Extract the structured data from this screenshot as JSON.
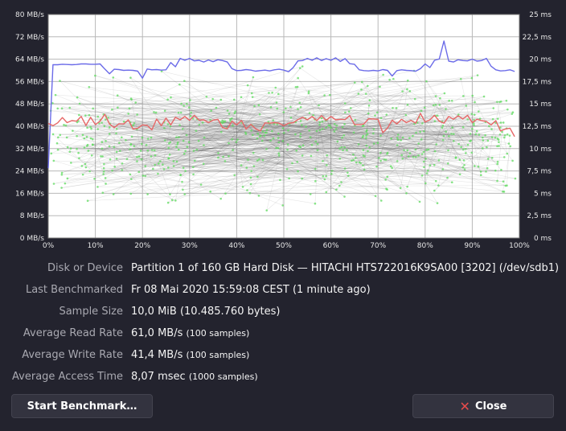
{
  "chart_data": {
    "type": "line",
    "y_left": {
      "unit": "MB/s",
      "ticks": [
        "0 MB/s",
        "8 MB/s",
        "16 MB/s",
        "24 MB/s",
        "32 MB/s",
        "40 MB/s",
        "48 MB/s",
        "56 MB/s",
        "64 MB/s",
        "72 MB/s",
        "80 MB/s"
      ],
      "range": [
        0,
        80
      ]
    },
    "y_right": {
      "unit": "ms",
      "ticks": [
        "0 ms",
        "2,5 ms",
        "5 ms",
        "7,5 ms",
        "10 ms",
        "12,5 ms",
        "15 ms",
        "17,5 ms",
        "20 ms",
        "22,5 ms",
        "25 ms"
      ],
      "range": [
        0,
        25
      ]
    },
    "x_axis": {
      "ticks": [
        "0%",
        "10%",
        "20%",
        "30%",
        "40%",
        "50%",
        "60%",
        "70%",
        "80%",
        "90%",
        "100%"
      ],
      "range": [
        0,
        100
      ]
    },
    "grid": true,
    "series": [
      {
        "name": "read",
        "color": "#6b6be8",
        "x": [
          0,
          1,
          2,
          3,
          4,
          5,
          6,
          7,
          8,
          9,
          10,
          11,
          12,
          13,
          14,
          15,
          16,
          17,
          18,
          19,
          20,
          21,
          22,
          23,
          24,
          25,
          26,
          27,
          28,
          29,
          30,
          31,
          32,
          33,
          34,
          35,
          36,
          37,
          38,
          39,
          40,
          41,
          42,
          43,
          44,
          45,
          46,
          47,
          48,
          49,
          50,
          51,
          52,
          53,
          54,
          55,
          56,
          57,
          58,
          59,
          60,
          61,
          62,
          63,
          64,
          65,
          66,
          67,
          68,
          69,
          70,
          71,
          72,
          73,
          74,
          75,
          76,
          77,
          78,
          79,
          80,
          81,
          82,
          83,
          84,
          85,
          86,
          87,
          88,
          89,
          90,
          91,
          92,
          93,
          94,
          95,
          96,
          97,
          98,
          99
        ],
        "values": [
          25,
          62,
          62,
          62.2,
          62.1,
          62,
          62.1,
          62.3,
          62.3,
          62.2,
          62.2,
          62.3,
          60.5,
          58.8,
          60.4,
          60.3,
          60,
          60.1,
          60,
          59.7,
          57.2,
          60.5,
          60.2,
          60.3,
          60.1,
          60.2,
          62.8,
          61.3,
          64.3,
          63.6,
          64.3,
          63.4,
          63.6,
          63,
          63.7,
          63.1,
          63.8,
          63.5,
          63,
          60.6,
          59.9,
          60,
          60.3,
          60.1,
          59.7,
          59.9,
          60.1,
          59.8,
          60.2,
          60.4,
          60.1,
          59.5,
          61,
          63.4,
          63.5,
          64.3,
          63.6,
          64.5,
          63.5,
          64.2,
          63.6,
          64.5,
          63.2,
          64.2,
          62.4,
          62.2,
          60.2,
          59.9,
          59.8,
          60,
          59.8,
          60.3,
          60,
          58,
          59.9,
          60.2,
          60,
          59.9,
          59.7,
          60.6,
          62.3,
          61,
          63.6,
          64.1,
          70.5,
          63.3,
          63,
          63.8,
          63.5,
          63.4,
          64,
          63.3,
          63.5,
          64.3,
          61.5,
          60.2,
          59.8,
          59.9,
          60.2,
          59.6
        ]
      },
      {
        "name": "write",
        "color": "#e66767",
        "x": [
          0,
          1,
          2,
          3,
          4,
          5,
          6,
          7,
          8,
          9,
          10,
          11,
          12,
          13,
          14,
          15,
          16,
          17,
          18,
          19,
          20,
          21,
          22,
          23,
          24,
          25,
          26,
          27,
          28,
          29,
          30,
          31,
          32,
          33,
          34,
          35,
          36,
          37,
          38,
          39,
          40,
          41,
          42,
          43,
          44,
          45,
          46,
          47,
          48,
          49,
          50,
          51,
          52,
          53,
          54,
          55,
          56,
          57,
          58,
          59,
          60,
          61,
          62,
          63,
          64,
          65,
          66,
          67,
          68,
          69,
          70,
          71,
          72,
          73,
          74,
          75,
          76,
          77,
          78,
          79,
          80,
          81,
          82,
          83,
          84,
          85,
          86,
          87,
          88,
          89,
          90,
          91,
          92,
          93,
          94,
          95,
          96,
          97,
          98,
          99
        ],
        "values": [
          41,
          40.2,
          41.2,
          43.1,
          41.3,
          42,
          41.8,
          43.5,
          40.3,
          43.2,
          40.6,
          41.8,
          44.3,
          40.8,
          39.5,
          40.9,
          40.8,
          42.3,
          39,
          39.3,
          40.5,
          40.3,
          38.7,
          42.6,
          40.2,
          42.9,
          40.5,
          43.2,
          42.3,
          43.5,
          42.1,
          43.9,
          42.2,
          42.3,
          41.3,
          42.2,
          42.5,
          39.5,
          39.1,
          41.8,
          40.5,
          42.1,
          39,
          40.7,
          39.1,
          38.3,
          41.2,
          41.1,
          41.3,
          41.1,
          40.2,
          41.1,
          41.3,
          42.4,
          43.2,
          42.3,
          43.5,
          42,
          43.8,
          42.1,
          43.5,
          42.3,
          42.5,
          42.4,
          43.8,
          40.6,
          40.6,
          40.8,
          42.7,
          42.6,
          42.5,
          37.7,
          39.3,
          42.2,
          40.8,
          42.5,
          41.3,
          42.1,
          41.1,
          44.6,
          41.5,
          42.3,
          43.9,
          41.8,
          41.1,
          43.5,
          42.5,
          43.7,
          42.6,
          43.9,
          41.3,
          42.5,
          42,
          41.7,
          40.5,
          42,
          38.3,
          39,
          39.3,
          36.3
        ]
      }
    ]
  },
  "colors": {
    "background": "#23232e",
    "plot_bg": "#ffffff",
    "read": "#6b6be8",
    "write": "#e66767",
    "access_points": "#5fdc5f"
  },
  "info": {
    "disk": {
      "label": "Disk or Device",
      "value": "Partition 1 of 160 GB Hard Disk — HITACHI HTS722016K9SA00 [3202] (/dev/sdb1)"
    },
    "last": {
      "label": "Last Benchmarked",
      "value": "Fr 08 Mai 2020 15:59:08 CEST (1 minute ago)"
    },
    "sample": {
      "label": "Sample Size",
      "value": "10,0 MiB (10.485.760 bytes)"
    },
    "read": {
      "label": "Average Read Rate",
      "value": "61,0 MB/s",
      "note": "(100 samples)"
    },
    "write": {
      "label": "Average Write Rate",
      "value": "41,4 MB/s",
      "note": "(100 samples)"
    },
    "access": {
      "label": "Average Access Time",
      "value": "8,07 msec",
      "note": "(1000 samples)"
    }
  },
  "buttons": {
    "start": "Start Benchmark…",
    "close": "Close",
    "close_icon": "x-icon"
  }
}
